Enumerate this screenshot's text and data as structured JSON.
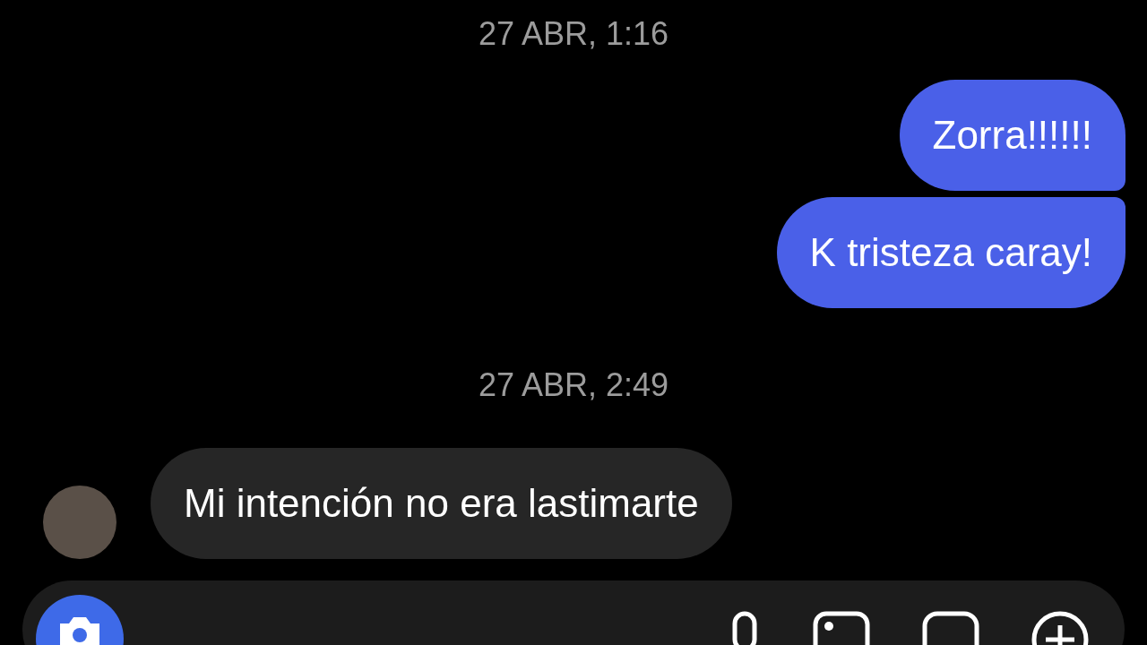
{
  "thread": [
    {
      "kind": "timestamp",
      "text": "27 ABR, 1:16"
    },
    {
      "kind": "outgoing",
      "text": "Zorra!!!!!!"
    },
    {
      "kind": "outgoing",
      "text": "K tristeza caray!"
    },
    {
      "kind": "timestamp",
      "text": "27 ABR, 2:49"
    },
    {
      "kind": "incoming",
      "text": "Mi intención no era lastimarte"
    }
  ]
}
